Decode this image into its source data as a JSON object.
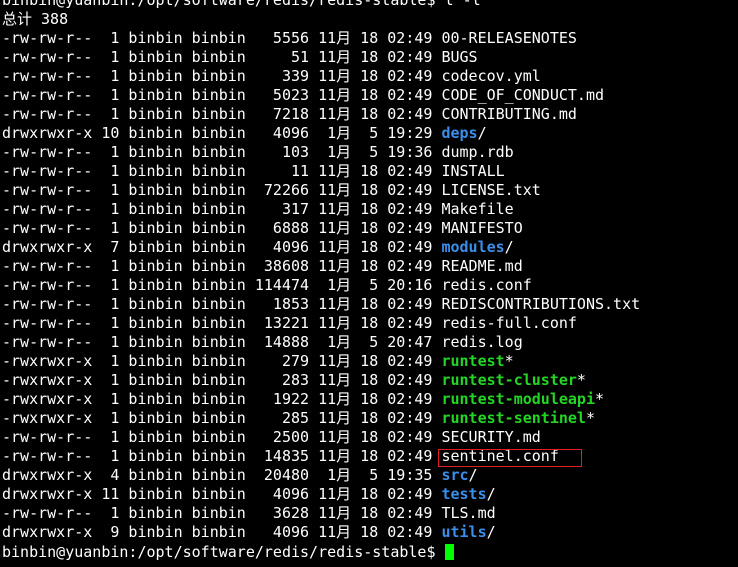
{
  "terminal": {
    "command_line": "binbin@yuanbin:/opt/software/redis/redis-stable$ l -l",
    "total_line": "总计 388",
    "prompt": "binbin@yuanbin:/opt/software/redis/redis-stable$ ",
    "highlighted_file": "sentinel.conf",
    "colors": {
      "background": "#000000",
      "text": "#ffffff",
      "directory": "#3b8eea",
      "executable": "#23d623",
      "highlight_box": "#e02020",
      "cursor": "#00ff00"
    },
    "entries": [
      {
        "meta": "-rw-rw-r--  1 binbin binbin   5556 11月 18 02:49 ",
        "name": "00-RELEASENOTES",
        "type": "file",
        "suffix": ""
      },
      {
        "meta": "-rw-rw-r--  1 binbin binbin     51 11月 18 02:49 ",
        "name": "BUGS",
        "type": "file",
        "suffix": ""
      },
      {
        "meta": "-rw-rw-r--  1 binbin binbin    339 11月 18 02:49 ",
        "name": "codecov.yml",
        "type": "file",
        "suffix": ""
      },
      {
        "meta": "-rw-rw-r--  1 binbin binbin   5023 11月 18 02:49 ",
        "name": "CODE_OF_CONDUCT.md",
        "type": "file",
        "suffix": ""
      },
      {
        "meta": "-rw-rw-r--  1 binbin binbin   7218 11月 18 02:49 ",
        "name": "CONTRIBUTING.md",
        "type": "file",
        "suffix": ""
      },
      {
        "meta": "drwxrwxr-x 10 binbin binbin   4096  1月  5 19:29 ",
        "name": "deps",
        "type": "dir",
        "suffix": "/"
      },
      {
        "meta": "-rw-rw-r--  1 binbin binbin    103  1月  5 19:36 ",
        "name": "dump.rdb",
        "type": "file",
        "suffix": ""
      },
      {
        "meta": "-rw-rw-r--  1 binbin binbin     11 11月 18 02:49 ",
        "name": "INSTALL",
        "type": "file",
        "suffix": ""
      },
      {
        "meta": "-rw-rw-r--  1 binbin binbin  72266 11月 18 02:49 ",
        "name": "LICENSE.txt",
        "type": "file",
        "suffix": ""
      },
      {
        "meta": "-rw-rw-r--  1 binbin binbin    317 11月 18 02:49 ",
        "name": "Makefile",
        "type": "file",
        "suffix": ""
      },
      {
        "meta": "-rw-rw-r--  1 binbin binbin   6888 11月 18 02:49 ",
        "name": "MANIFESTO",
        "type": "file",
        "suffix": ""
      },
      {
        "meta": "drwxrwxr-x  7 binbin binbin   4096 11月 18 02:49 ",
        "name": "modules",
        "type": "dir",
        "suffix": "/"
      },
      {
        "meta": "-rw-rw-r--  1 binbin binbin  38608 11月 18 02:49 ",
        "name": "README.md",
        "type": "file",
        "suffix": ""
      },
      {
        "meta": "-rw-rw-r--  1 binbin binbin 114474  1月  5 20:16 ",
        "name": "redis.conf",
        "type": "file",
        "suffix": ""
      },
      {
        "meta": "-rw-rw-r--  1 binbin binbin   1853 11月 18 02:49 ",
        "name": "REDISCONTRIBUTIONS.txt",
        "type": "file",
        "suffix": ""
      },
      {
        "meta": "-rw-rw-r--  1 binbin binbin  13221 11月 18 02:49 ",
        "name": "redis-full.conf",
        "type": "file",
        "suffix": ""
      },
      {
        "meta": "-rw-rw-r--  1 binbin binbin  14888  1月  5 20:47 ",
        "name": "redis.log",
        "type": "file",
        "suffix": ""
      },
      {
        "meta": "-rwxrwxr-x  1 binbin binbin    279 11月 18 02:49 ",
        "name": "runtest",
        "type": "exe",
        "suffix": "*"
      },
      {
        "meta": "-rwxrwxr-x  1 binbin binbin    283 11月 18 02:49 ",
        "name": "runtest-cluster",
        "type": "exe",
        "suffix": "*"
      },
      {
        "meta": "-rwxrwxr-x  1 binbin binbin   1922 11月 18 02:49 ",
        "name": "runtest-moduleapi",
        "type": "exe",
        "suffix": "*"
      },
      {
        "meta": "-rwxrwxr-x  1 binbin binbin    285 11月 18 02:49 ",
        "name": "runtest-sentinel",
        "type": "exe",
        "suffix": "*"
      },
      {
        "meta": "-rw-rw-r--  1 binbin binbin   2500 11月 18 02:49 ",
        "name": "SECURITY.md",
        "type": "file",
        "suffix": ""
      },
      {
        "meta": "-rw-rw-r--  1 binbin binbin  14835 11月 18 02:49 ",
        "name": "sentinel.conf",
        "type": "file",
        "suffix": ""
      },
      {
        "meta": "drwxrwxr-x  4 binbin binbin  20480  1月  5 19:35 ",
        "name": "src",
        "type": "dir",
        "suffix": "/"
      },
      {
        "meta": "drwxrwxr-x 11 binbin binbin   4096 11月 18 02:49 ",
        "name": "tests",
        "type": "dir",
        "suffix": "/"
      },
      {
        "meta": "-rw-rw-r--  1 binbin binbin   3628 11月 18 02:49 ",
        "name": "TLS.md",
        "type": "file",
        "suffix": ""
      },
      {
        "meta": "drwxrwxr-x  9 binbin binbin   4096 11月 18 02:49 ",
        "name": "utils",
        "type": "dir",
        "suffix": "/"
      }
    ]
  }
}
